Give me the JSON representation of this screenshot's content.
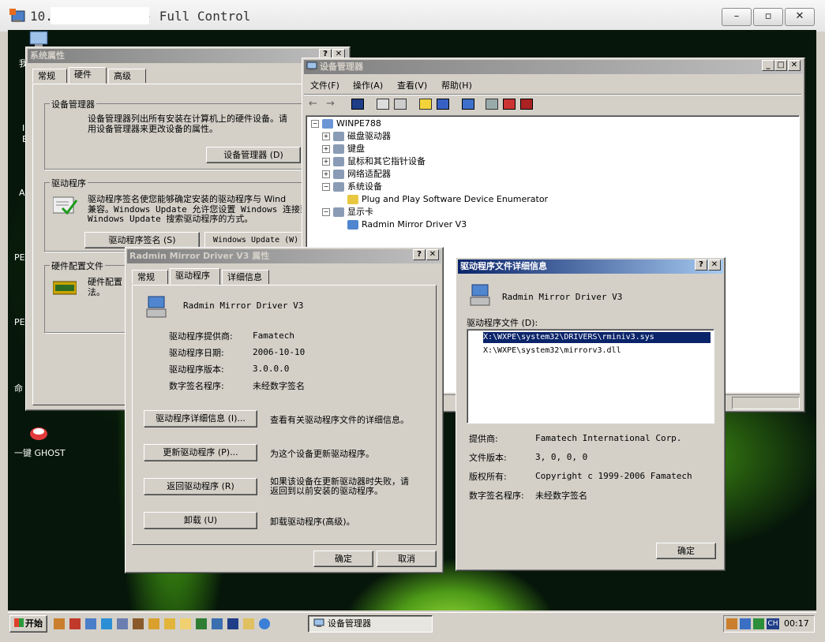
{
  "outer": {
    "title": "10.            - Full Control"
  },
  "desktop": {
    "labels": [
      "我",
      "I",
      "E",
      "A",
      "PE",
      "PE",
      "命",
      "一键 GHOST"
    ]
  },
  "sysprops": {
    "title": "系统属性",
    "tabs": [
      "常规",
      "硬件",
      "高级"
    ],
    "devmgr_group": "设备管理器",
    "devmgr_text": "设备管理器列出所有安装在计算机上的硬件设备。请使用设备管理器来更改设备的属性。",
    "devmgr_text_l1": "设备管理器列出所有安装在计算机上的硬件设备。请",
    "devmgr_text_l2": "用设备管理器来更改设备的属性。",
    "devmgr_btn": "设备管理器 (D)",
    "driver_group": "驱动程序",
    "driver_text_l1": "驱动程序签名使您能够确定安装的驱动程序与 Wind",
    "driver_text_l2": "兼容。Windows Update 允许您设置 Windows 连接到",
    "driver_text_l3": "Windows Update 搜索驱动程序的方式。",
    "sign_btn": "驱动程序签名 (S)",
    "wu_btn": "Windows Update (W)",
    "hwprofile_group": "硬件配置文件",
    "hwprofile_text_l1": "硬件配置",
    "hwprofile_text_l2": "法。"
  },
  "devmgr": {
    "title": "设备管理器",
    "menu": [
      "文件(F)",
      "操作(A)",
      "查看(V)",
      "帮助(H)"
    ],
    "tree": [
      {
        "label": "WINPE788",
        "level": 0,
        "exp": "-"
      },
      {
        "label": "磁盘驱动器",
        "level": 1,
        "exp": "+"
      },
      {
        "label": "键盘",
        "level": 1,
        "exp": "+"
      },
      {
        "label": "鼠标和其它指针设备",
        "level": 1,
        "exp": "+"
      },
      {
        "label": "网络适配器",
        "level": 1,
        "exp": "+"
      },
      {
        "label": "系统设备",
        "level": 1,
        "exp": "-"
      },
      {
        "label": "Plug and Play Software Device Enumerator",
        "level": 2,
        "exp": ""
      },
      {
        "label": "显示卡",
        "level": 1,
        "exp": "-"
      },
      {
        "label": "Radmin Mirror Driver V3",
        "level": 2,
        "exp": ""
      }
    ]
  },
  "radmin": {
    "title": "Radmin Mirror Driver V3 属性",
    "tabs": [
      "常规",
      "驱动程序",
      "详细信息"
    ],
    "device": "Radmin Mirror Driver V3",
    "rows": [
      {
        "k": "驱动程序提供商:",
        "v": "Famatech"
      },
      {
        "k": "驱动程序日期:",
        "v": "2006-10-10"
      },
      {
        "k": "驱动程序版本:",
        "v": "3.0.0.0"
      },
      {
        "k": "数字签名程序:",
        "v": "未经数字签名"
      }
    ],
    "actions": [
      {
        "btn": "驱动程序详细信息 (I)...",
        "desc": "查看有关驱动程序文件的详细信息。"
      },
      {
        "btn": "更新驱动程序 (P)...",
        "desc": "为这个设备更新驱动程序。"
      },
      {
        "btn": "返回驱动程序 (R)",
        "desc": "如果该设备在更新驱动器时失败，请返回到以前安装的驱动程序。",
        "desc_l1": "如果该设备在更新驱动器时失败，请",
        "desc_l2": "返回到以前安装的驱动程序。"
      },
      {
        "btn": "卸载 (U)",
        "desc": "卸载驱动程序(高级)。"
      }
    ],
    "ok": "确定",
    "cancel": "取消"
  },
  "details": {
    "title": "驱动程序文件详细信息",
    "device": "Radmin Mirror Driver V3",
    "files_label": "驱动程序文件 (D):",
    "files": [
      "X:\\WXPE\\system32\\DRIVERS\\rminiv3.sys",
      "X:\\WXPE\\system32\\mirrorv3.dll"
    ],
    "rows": [
      {
        "k": "提供商:",
        "v": "Famatech International Corp."
      },
      {
        "k": "文件版本:",
        "v": "3, 0, 0, 0"
      },
      {
        "k": "版权所有:",
        "v": "Copyright c 1999-2006 Famatech"
      },
      {
        "k": "数字签名程序:",
        "v": "未经数字签名"
      }
    ],
    "ok": "确定"
  },
  "taskbar": {
    "start": "开始",
    "task": "设备管理器",
    "lang": "CH",
    "clock": "00:17"
  }
}
